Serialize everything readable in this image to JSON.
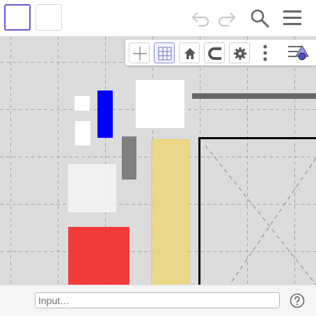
{
  "window": {
    "tiles": [
      {
        "name": "view-tile-1",
        "active": true
      },
      {
        "name": "view-tile-2",
        "active": false
      }
    ]
  },
  "toolbar": {
    "icons": [
      "undo-icon",
      "redo-icon",
      "search-icon",
      "menu-icon"
    ]
  },
  "stylebar": {
    "buttons": [
      {
        "icon": "axes-icon",
        "selected": false
      },
      {
        "icon": "grid-icon",
        "selected": true
      },
      {
        "icon": "home-icon",
        "selected": false
      },
      {
        "icon": "magnet-icon",
        "selected": false
      },
      {
        "icon": "gear-icon",
        "selected": false
      },
      {
        "icon": "more-vertical-icon",
        "selected": false
      },
      {
        "icon": "graphics-style-icon",
        "selected": false
      }
    ]
  },
  "shapes": {
    "white_small_1": {
      "color": "#ffffff"
    },
    "white_small_2": {
      "color": "#ffffff"
    },
    "blue_bar": {
      "color": "#0000ff"
    },
    "white_square": {
      "color": "#ffffff"
    },
    "gray_line": {
      "color": "#666666"
    },
    "gray_bar": {
      "color": "#808080"
    },
    "yellow_bar": {
      "color": "#ecdc8c"
    },
    "light_square": {
      "color": "#efefef"
    },
    "red_square": {
      "color": "#f43a3a"
    },
    "image_frame": {
      "color": "#000000"
    }
  },
  "colors": {
    "accent": "#6557d2",
    "canvas_background": "#dcdcdc",
    "grid_line": "#a8a8a8"
  },
  "input": {
    "placeholder": "Input…",
    "value": ""
  },
  "help": {
    "icon": "help-icon"
  }
}
